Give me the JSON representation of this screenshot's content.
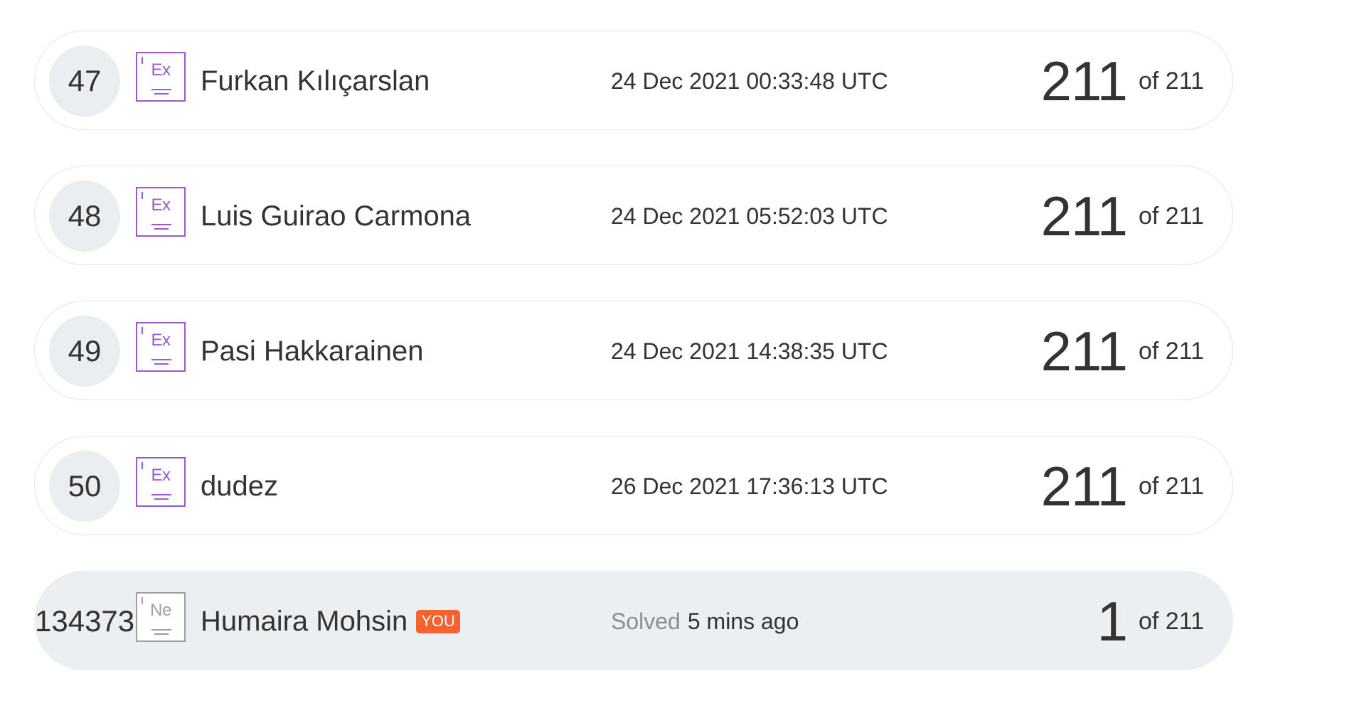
{
  "rows": [
    {
      "rank": "47",
      "badge": "Ex",
      "name": "Furkan Kılıçarslan",
      "date": "24 Dec 2021 00:33:48 UTC",
      "score": "211",
      "total": "of 211"
    },
    {
      "rank": "48",
      "badge": "Ex",
      "name": "Luis Guirao Carmona",
      "date": "24 Dec 2021 05:52:03 UTC",
      "score": "211",
      "total": "of 211"
    },
    {
      "rank": "49",
      "badge": "Ex",
      "name": "Pasi Hakkarainen",
      "date": "24 Dec 2021 14:38:35 UTC",
      "score": "211",
      "total": "of 211"
    },
    {
      "rank": "50",
      "badge": "Ex",
      "name": "dudez",
      "date": "26 Dec 2021 17:36:13 UTC",
      "score": "211",
      "total": "of 211"
    }
  ],
  "current_user": {
    "rank": "134373",
    "badge": "Ne",
    "name": "Humaira Mohsin",
    "you_tag": "YOU",
    "solved_label": "Solved",
    "solved_time": "5 mins ago",
    "score": "1",
    "total": "of 211"
  },
  "colors": {
    "expert_badge": "#9b5cc9",
    "newbie_badge": "#9aa0a6",
    "you_tag": "#f4622f",
    "current_row_bg": "#eceff2"
  }
}
